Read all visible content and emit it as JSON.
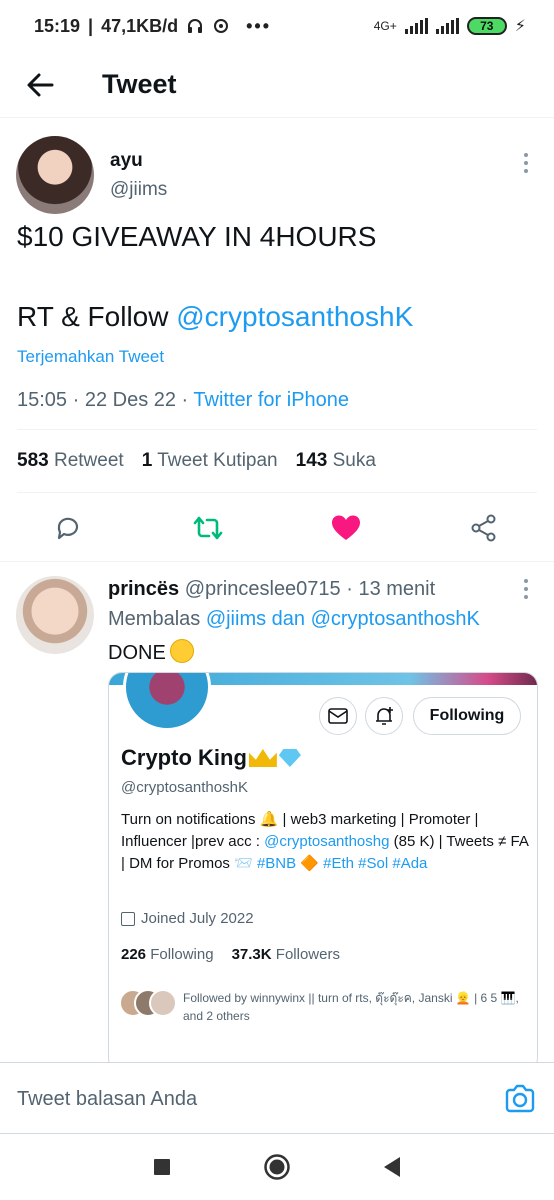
{
  "status_bar": {
    "time": "15:19",
    "speed": "47,1KB/d",
    "network": "4G+",
    "battery": "73"
  },
  "header": {
    "title": "Tweet"
  },
  "main_tweet": {
    "author_name": "ayu",
    "author_handle": "@jiims",
    "line1": "$10 GIVEAWAY IN 4HOURS",
    "line2_prefix": "RT & Follow ",
    "line2_mention": "@cryptosanthoshK",
    "translate": "Terjemahkan Tweet",
    "timestamp": "15:05 · 22 Des 22 · ",
    "source": "Twitter for iPhone",
    "stats": {
      "retweets_count": "583",
      "retweets_label": "Retweet",
      "quotes_count": "1",
      "quotes_label": "Tweet Kutipan",
      "likes_count": "143",
      "likes_label": "Suka"
    }
  },
  "reply": {
    "name": "princës",
    "handle_time": "@princeslee0715 · 13 menit",
    "replying_prefix": "Membalas ",
    "replying_mentions": "@jiims dan @cryptosanthoshK",
    "text": "DONE",
    "card": {
      "following_label": "Following",
      "name": "Crypto King",
      "handle": "@cryptosanthoshK",
      "bio_1": "Turn on notifications 🔔 |   web3 marketing | Promoter | Influencer   |prev acc : ",
      "bio_link": "@cryptosanthoshg",
      "bio_2": " (85 K) | Tweets ≠ FA | DM for Promos 📨 ",
      "bio_tags": "#BNB 🔶 #Eth #Sol #Ada",
      "joined": "Joined July 2022",
      "following_count": "226",
      "following_text": "Following",
      "followers_count": "37.3K",
      "followers_text": "Followers",
      "followed_by": "Followed by winnywinx || turn of rts, ดุ๊ะดุ๊ะค, Janski 👱 | 6 5 🎹, and 2 others"
    }
  },
  "composer": {
    "placeholder": "Tweet balasan Anda"
  },
  "colors": {
    "link": "#1d9bf0",
    "retweet": "#00ba7c",
    "like": "#f91880",
    "secondary": "#536471"
  }
}
